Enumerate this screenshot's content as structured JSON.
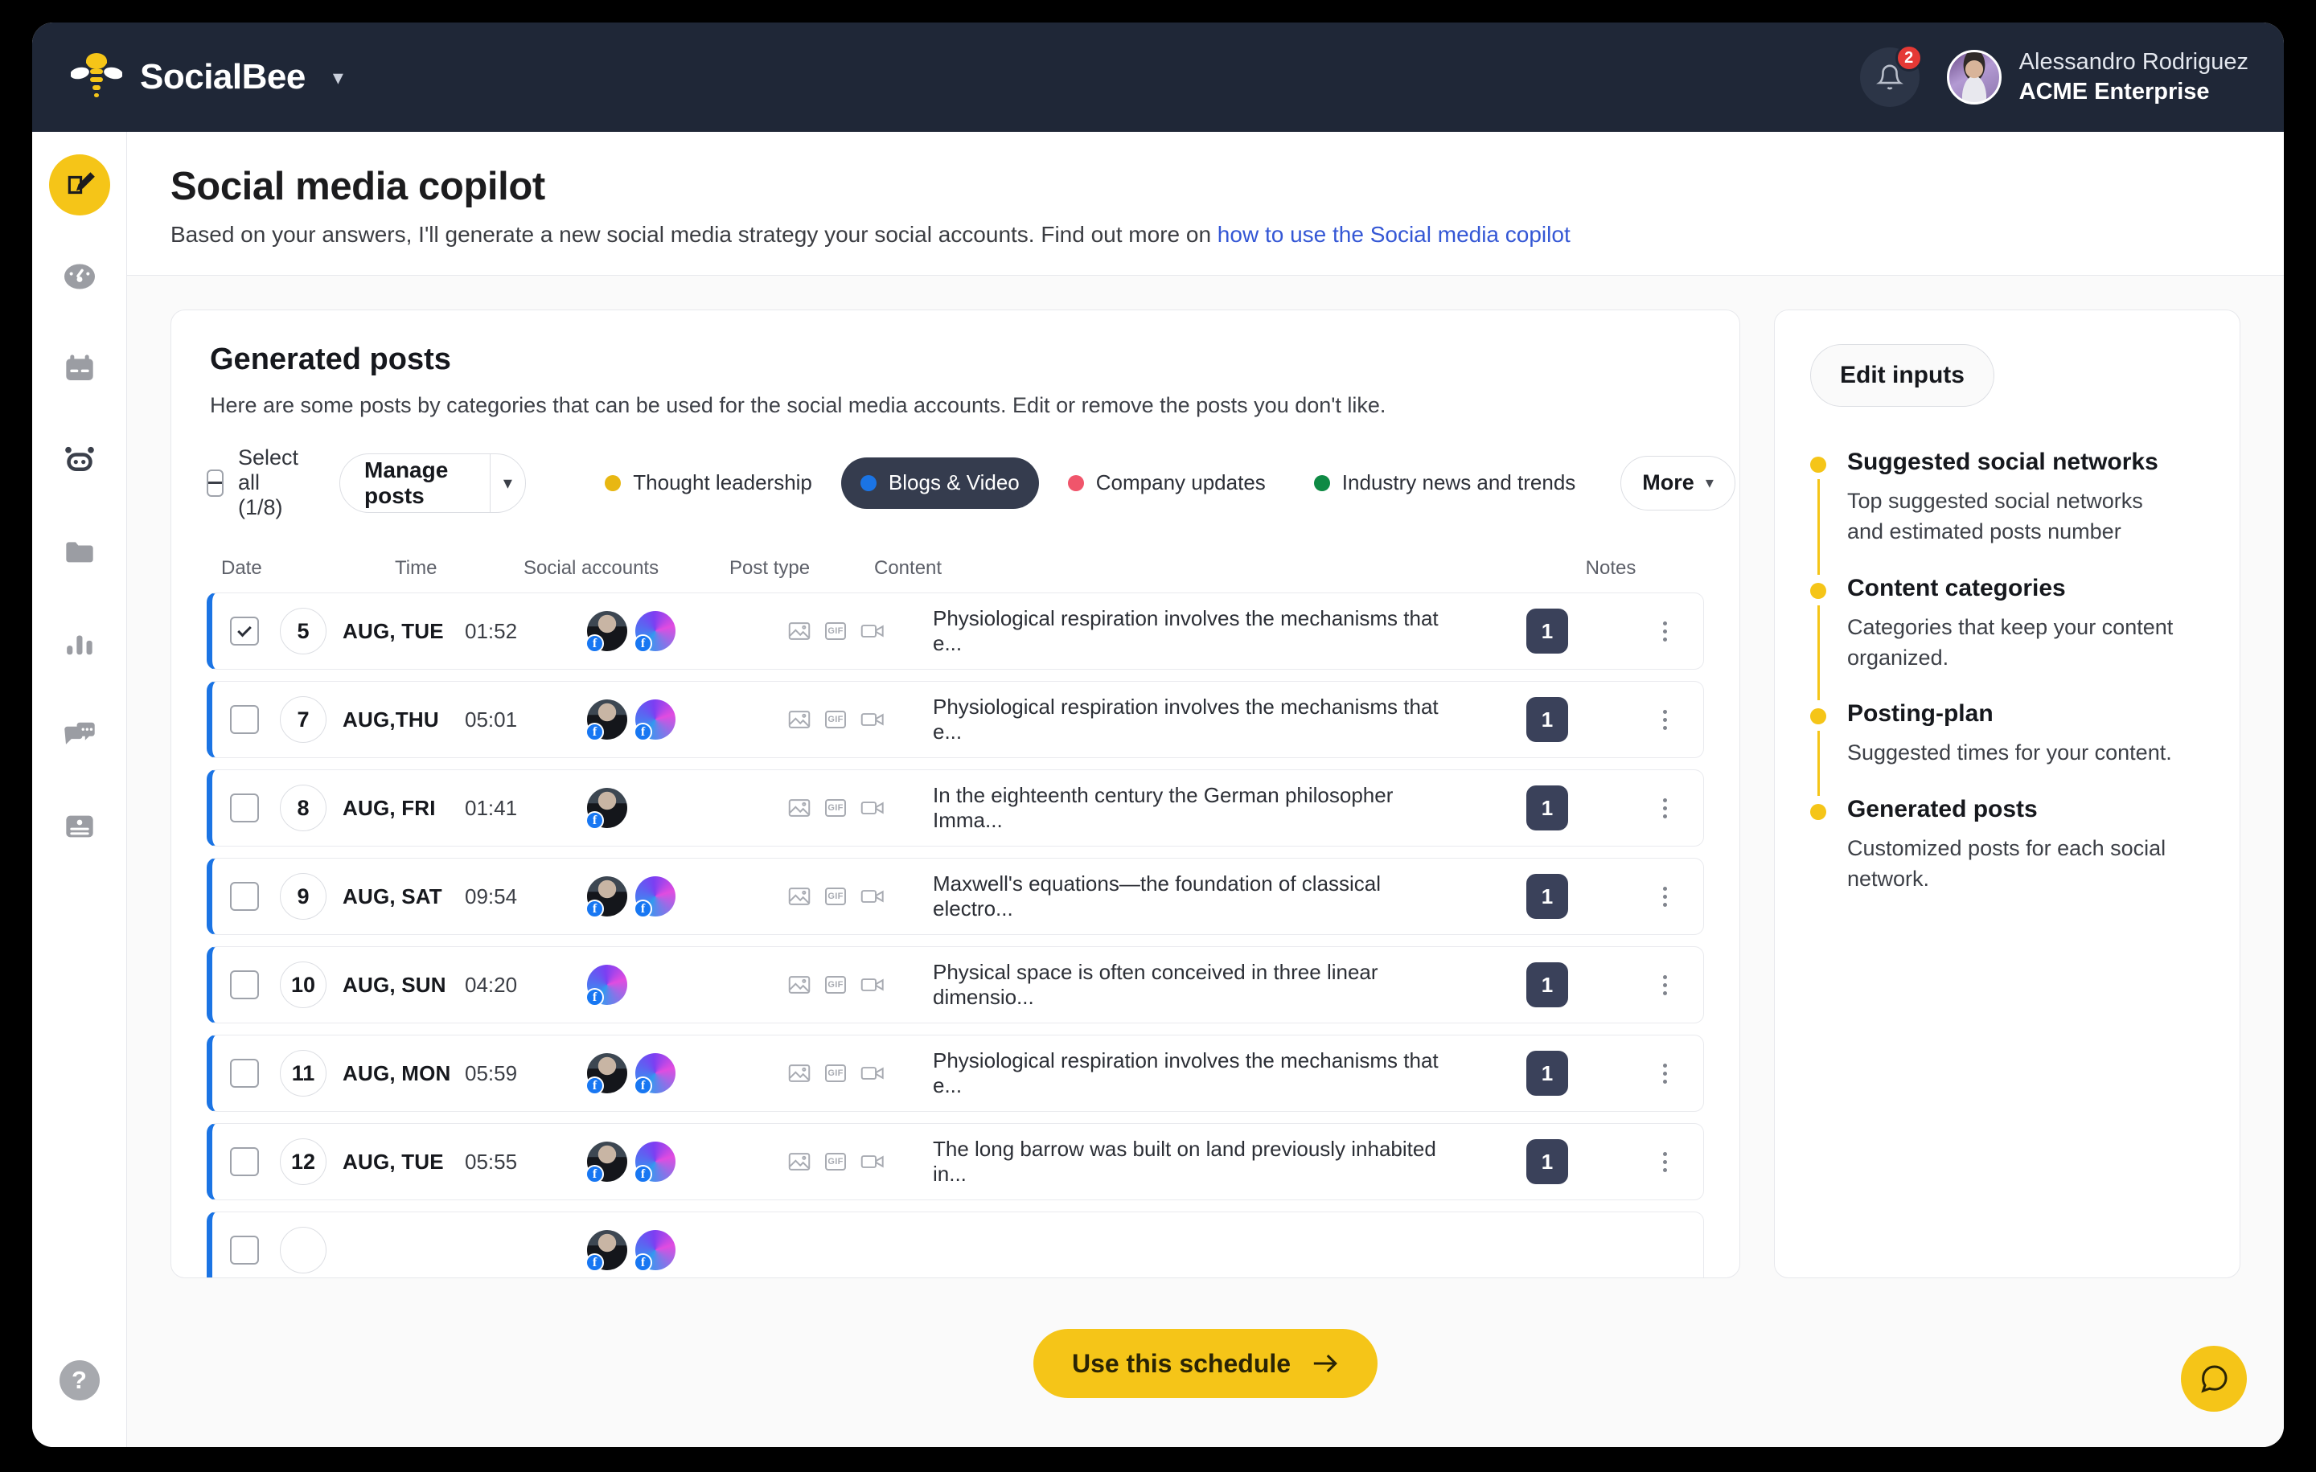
{
  "topbar": {
    "brand": "SocialBee",
    "brand_caret_icon": "chevron-down-icon",
    "bell_icon": "bell-icon",
    "notification_count": "2",
    "user_name": "Alessandro Rodriguez",
    "user_org": "ACME Enterprise"
  },
  "rail": {
    "items": [
      {
        "icon": "compose-icon",
        "active": true
      },
      {
        "icon": "dashboard-gauge-icon",
        "active": false
      },
      {
        "icon": "calendar-icon",
        "active": false
      },
      {
        "icon": "bot-icon",
        "active": false
      },
      {
        "icon": "folder-icon",
        "active": false
      },
      {
        "icon": "analytics-bars-icon",
        "active": false
      },
      {
        "icon": "messages-icon",
        "active": false
      },
      {
        "icon": "content-card-icon",
        "active": false
      }
    ],
    "help_label": "?"
  },
  "page": {
    "title": "Social media copilot",
    "subtitle_text": "Based on your answers, I'll generate a new social media strategy  your social accounts. Find out more on ",
    "subtitle_link": "how to use the Social media copilot"
  },
  "card": {
    "title": "Generated posts",
    "description": "Here are some posts by categories that can be used for the social media accounts. Edit or remove the posts you don't like."
  },
  "toolbar": {
    "select_all_label": "Select all (1/8)",
    "select_all_state": "indeterminate",
    "manage_posts_label": "Manage posts",
    "manage_posts_caret_icon": "chevron-down-icon",
    "more_label": "More",
    "more_caret_icon": "chevron-down-icon",
    "categories": [
      {
        "label": "Thought leadership",
        "color": "#e8b712",
        "active": false
      },
      {
        "label": "Blogs & Video",
        "color": "#1b74e4",
        "active": true
      },
      {
        "label": "Company updates",
        "color": "#f0556b",
        "active": false
      },
      {
        "label": "Industry news and trends",
        "color": "#0e8a44",
        "active": false
      }
    ]
  },
  "table": {
    "columns": [
      "Date",
      "Time",
      "Social accounts",
      "Post type",
      "Content",
      "Notes"
    ],
    "rows": [
      {
        "checked": true,
        "day": "5",
        "day_label": "AUG, TUE",
        "time": "01:52",
        "accounts": [
          "person",
          "gradient"
        ],
        "post_types": [
          "image-icon",
          "gif-icon",
          "video-icon"
        ],
        "content": "Physiological respiration involves the mechanisms that e...",
        "notes": "1"
      },
      {
        "checked": false,
        "day": "7",
        "day_label": "AUG,THU",
        "time": "05:01",
        "accounts": [
          "person",
          "gradient"
        ],
        "post_types": [
          "image-icon",
          "gif-icon",
          "video-icon"
        ],
        "content": "Physiological respiration involves the mechanisms that e...",
        "notes": "1"
      },
      {
        "checked": false,
        "day": "8",
        "day_label": "AUG, FRI",
        "time": "01:41",
        "accounts": [
          "person"
        ],
        "post_types": [
          "image-icon",
          "gif-icon",
          "video-icon"
        ],
        "content": "In the eighteenth century the German philosopher Imma...",
        "notes": "1"
      },
      {
        "checked": false,
        "day": "9",
        "day_label": "AUG, SAT",
        "time": "09:54",
        "accounts": [
          "person",
          "gradient"
        ],
        "post_types": [
          "image-icon",
          "gif-icon",
          "video-icon"
        ],
        "content": "Maxwell's equations—the foundation of classical electro...",
        "notes": "1"
      },
      {
        "checked": false,
        "day": "10",
        "day_label": "AUG, SUN",
        "time": "04:20",
        "accounts": [
          "gradient"
        ],
        "post_types": [
          "image-icon",
          "gif-icon",
          "video-icon"
        ],
        "content": "Physical space is often conceived in three linear dimensio...",
        "notes": "1"
      },
      {
        "checked": false,
        "day": "11",
        "day_label": "AUG, MON",
        "time": "05:59",
        "accounts": [
          "person",
          "gradient"
        ],
        "post_types": [
          "image-icon",
          "gif-icon",
          "video-icon"
        ],
        "content": "Physiological respiration involves the mechanisms that e...",
        "notes": "1"
      },
      {
        "checked": false,
        "day": "12",
        "day_label": "AUG, TUE",
        "time": "05:55",
        "accounts": [
          "person",
          "gradient"
        ],
        "post_types": [
          "image-icon",
          "gif-icon",
          "video-icon"
        ],
        "content": "The long barrow was built on land previously inhabited in...",
        "notes": "1"
      },
      {
        "checked": false,
        "day": "",
        "day_label": "",
        "time": "",
        "accounts": [
          "person",
          "gradient"
        ],
        "post_types": [],
        "content": "",
        "notes": ""
      }
    ],
    "gif_label": "GIF"
  },
  "side": {
    "edit_inputs_label": "Edit inputs",
    "steps": [
      {
        "title": "Suggested social networks",
        "desc": "Top suggested social networks and estimated posts number"
      },
      {
        "title": "Content categories",
        "desc": "Categories that keep your content organized."
      },
      {
        "title": "Posting-plan",
        "desc": "Suggested times for your content."
      },
      {
        "title": "Generated posts",
        "desc": "Customized posts for each social network."
      }
    ]
  },
  "footer": {
    "cta_label": "Use this schedule",
    "cta_arrow_icon": "arrow-right-icon",
    "chat_icon": "chat-bubble-icon"
  },
  "colors": {
    "brand_yellow": "#f5c518",
    "dark_navy": "#1f2737",
    "accent_blue": "#1b74e4",
    "link_blue": "#3457d5",
    "badge_red": "#e53935"
  }
}
